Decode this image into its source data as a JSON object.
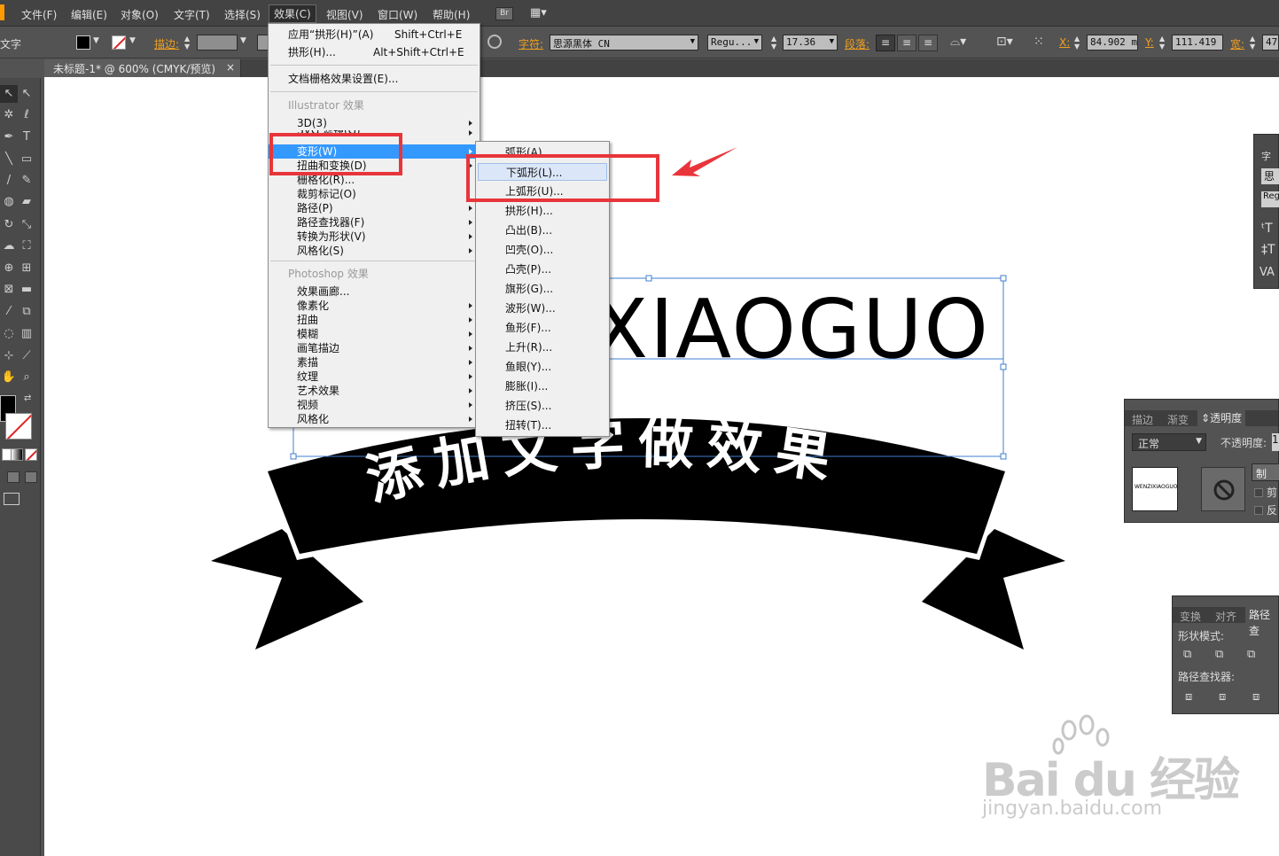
{
  "menubar": {
    "items": [
      "文件(F)",
      "编辑(E)",
      "对象(O)",
      "文字(T)",
      "选择(S)",
      "效果(C)",
      "视图(V)",
      "窗口(W)",
      "帮助(H)"
    ],
    "bridge_label": "Br"
  },
  "controlbar": {
    "tool_label": "文字",
    "stroke_label": "描边:",
    "char_label": "字符:",
    "font_family": "思源黑体 CN",
    "font_style": "Regu...",
    "font_size": "17.36",
    "para_label": "段落:",
    "x_label": "X:",
    "x_value": "84.902 m",
    "y_label": "Y:",
    "y_value": "111.419 ",
    "w_label": "宽:",
    "w_value": "47."
  },
  "document": {
    "tab_title": "未标题-1* @ 600% (CMYK/预览)",
    "close": "×"
  },
  "effect_menu": {
    "apply_label": "应用“拱形(H)”(A)",
    "apply_shortcut": "Shift+Ctrl+E",
    "arc_label": "拱形(H)...",
    "arc_shortcut": "Alt+Shift+Ctrl+E",
    "raster_settings": "文档栅格效果设置(E)...",
    "illustrator_section": "Illustrator 效果",
    "illustrator_items": [
      "3D(3)",
      "SVG 滤镜(G)",
      "变形(W)",
      "扭曲和变换(D)",
      "栅格化(R)...",
      "裁剪标记(O)",
      "路径(P)",
      "路径查找器(F)",
      "转换为形状(V)",
      "风格化(S)"
    ],
    "photoshop_section": "Photoshop 效果",
    "photoshop_items": [
      "效果画廊...",
      "像素化",
      "扭曲",
      "模糊",
      "画笔描边",
      "素描",
      "纹理",
      "艺术效果",
      "视频",
      "风格化"
    ]
  },
  "warp_submenu": {
    "items": [
      "弧形(A)...",
      "下弧形(L)...",
      "上弧形(U)...",
      "拱形(H)...",
      "凸出(B)...",
      "凹壳(O)...",
      "凸壳(P)...",
      "旗形(G)...",
      "波形(W)...",
      "鱼形(F)...",
      "上升(R)...",
      "鱼眼(Y)...",
      "膨胀(I)...",
      "挤压(S)...",
      "扭转(T)..."
    ]
  },
  "artwork": {
    "headline": "XIAOGUO",
    "banner_text": "添加文字做效果"
  },
  "char_panel": {
    "title": "字",
    "font": "思",
    "style": "Reg"
  },
  "transparency_panel": {
    "tabs": [
      "描边",
      "渐变",
      "透明度"
    ],
    "blend_mode": "正常",
    "opacity_label": "不透明度:",
    "opacity_value": "1",
    "thumb_text": "WENZIXIAOGUO",
    "make_mask": "制",
    "clip": "剪",
    "invert": "反"
  },
  "pathfinder_panel": {
    "tabs": [
      "变换",
      "对齐",
      "路径查"
    ],
    "shape_modes": "形状模式:",
    "pathfinders": "路径查找器:"
  },
  "watermark": {
    "logo": "Bai du 经验",
    "url": "jingyan.baidu.com"
  },
  "colors": {
    "accent_red": "#e8353b",
    "menu_highlight": "#3399ff",
    "panel_bg": "#535353"
  }
}
